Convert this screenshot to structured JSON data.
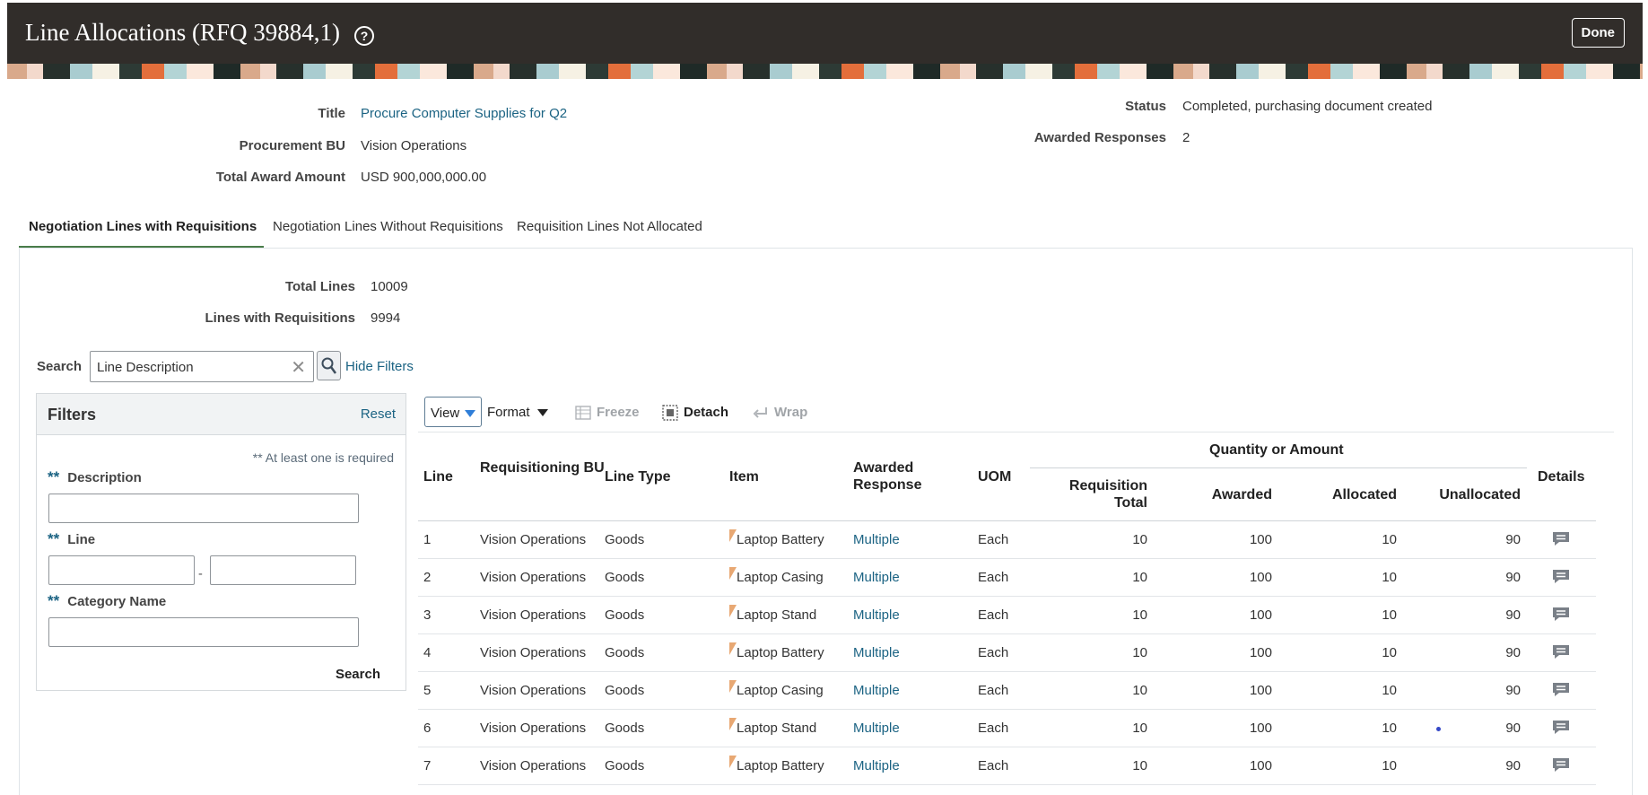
{
  "header": {
    "title": "Line Allocations (RFQ 39884,1)",
    "help_glyph": "?",
    "done_label": "Done"
  },
  "summary": {
    "title_label": "Title",
    "title_value": "Procure Computer Supplies for Q2",
    "bu_label": "Procurement BU",
    "bu_value": "Vision Operations",
    "amount_label": "Total Award Amount",
    "amount_value": "USD 900,000,000.00",
    "status_label": "Status",
    "status_value": "Completed, purchasing document created",
    "awarded_label": "Awarded Responses",
    "awarded_value": "2"
  },
  "tabs": [
    {
      "label": "Negotiation Lines with Requisitions",
      "active": true
    },
    {
      "label": "Negotiation Lines Without Requisitions",
      "active": false
    },
    {
      "label": "Requisition Lines Not Allocated",
      "active": false
    }
  ],
  "counts": {
    "total_lines_label": "Total Lines",
    "total_lines_value": "10009",
    "lines_req_label": "Lines with Requisitions",
    "lines_req_value": "9994"
  },
  "search": {
    "label": "Search",
    "value": "Line Description",
    "hide_filters": "Hide Filters"
  },
  "filters": {
    "title": "Filters",
    "reset": "Reset",
    "required_note": "** At least one is required",
    "required_mark": "**",
    "description_label": "Description",
    "line_label": "Line",
    "range_separator": "-",
    "category_label": "Category Name",
    "search_button": "Search"
  },
  "toolbar": {
    "view": "View",
    "format": "Format",
    "freeze": "Freeze",
    "detach": "Detach",
    "wrap": "Wrap"
  },
  "table": {
    "headers": {
      "line": "Line",
      "req_bu": "Requisitioning BU",
      "line_type": "Line Type",
      "item": "Item",
      "awarded_response": "Awarded Response",
      "uom": "UOM",
      "group": "Quantity or Amount",
      "req_total": "Requisition Total",
      "awarded": "Awarded",
      "allocated": "Allocated",
      "unallocated": "Unallocated",
      "details": "Details"
    },
    "rows": [
      {
        "line": "1",
        "bu": "Vision Operations",
        "type": "Goods",
        "item": "Laptop Battery",
        "response": "Multiple",
        "uom": "Each",
        "req_total": "10",
        "awarded": "100",
        "allocated": "10",
        "unallocated": "90"
      },
      {
        "line": "2",
        "bu": "Vision Operations",
        "type": "Goods",
        "item": "Laptop Casing",
        "response": "Multiple",
        "uom": "Each",
        "req_total": "10",
        "awarded": "100",
        "allocated": "10",
        "unallocated": "90"
      },
      {
        "line": "3",
        "bu": "Vision Operations",
        "type": "Goods",
        "item": "Laptop Stand",
        "response": "Multiple",
        "uom": "Each",
        "req_total": "10",
        "awarded": "100",
        "allocated": "10",
        "unallocated": "90"
      },
      {
        "line": "4",
        "bu": "Vision Operations",
        "type": "Goods",
        "item": "Laptop Battery",
        "response": "Multiple",
        "uom": "Each",
        "req_total": "10",
        "awarded": "100",
        "allocated": "10",
        "unallocated": "90"
      },
      {
        "line": "5",
        "bu": "Vision Operations",
        "type": "Goods",
        "item": "Laptop Casing",
        "response": "Multiple",
        "uom": "Each",
        "req_total": "10",
        "awarded": "100",
        "allocated": "10",
        "unallocated": "90"
      },
      {
        "line": "6",
        "bu": "Vision Operations",
        "type": "Goods",
        "item": "Laptop Stand",
        "response": "Multiple",
        "uom": "Each",
        "req_total": "10",
        "awarded": "100",
        "allocated": "10",
        "unallocated": "90"
      },
      {
        "line": "7",
        "bu": "Vision Operations",
        "type": "Goods",
        "item": "Laptop Battery",
        "response": "Multiple",
        "uom": "Each",
        "req_total": "10",
        "awarded": "100",
        "allocated": "10",
        "unallocated": "90"
      }
    ]
  },
  "colors": {
    "header_bg": "#312d2a",
    "link": "#1b6383",
    "tab_active": "#4a7d4a",
    "view_caret": "#2f7ed8"
  }
}
